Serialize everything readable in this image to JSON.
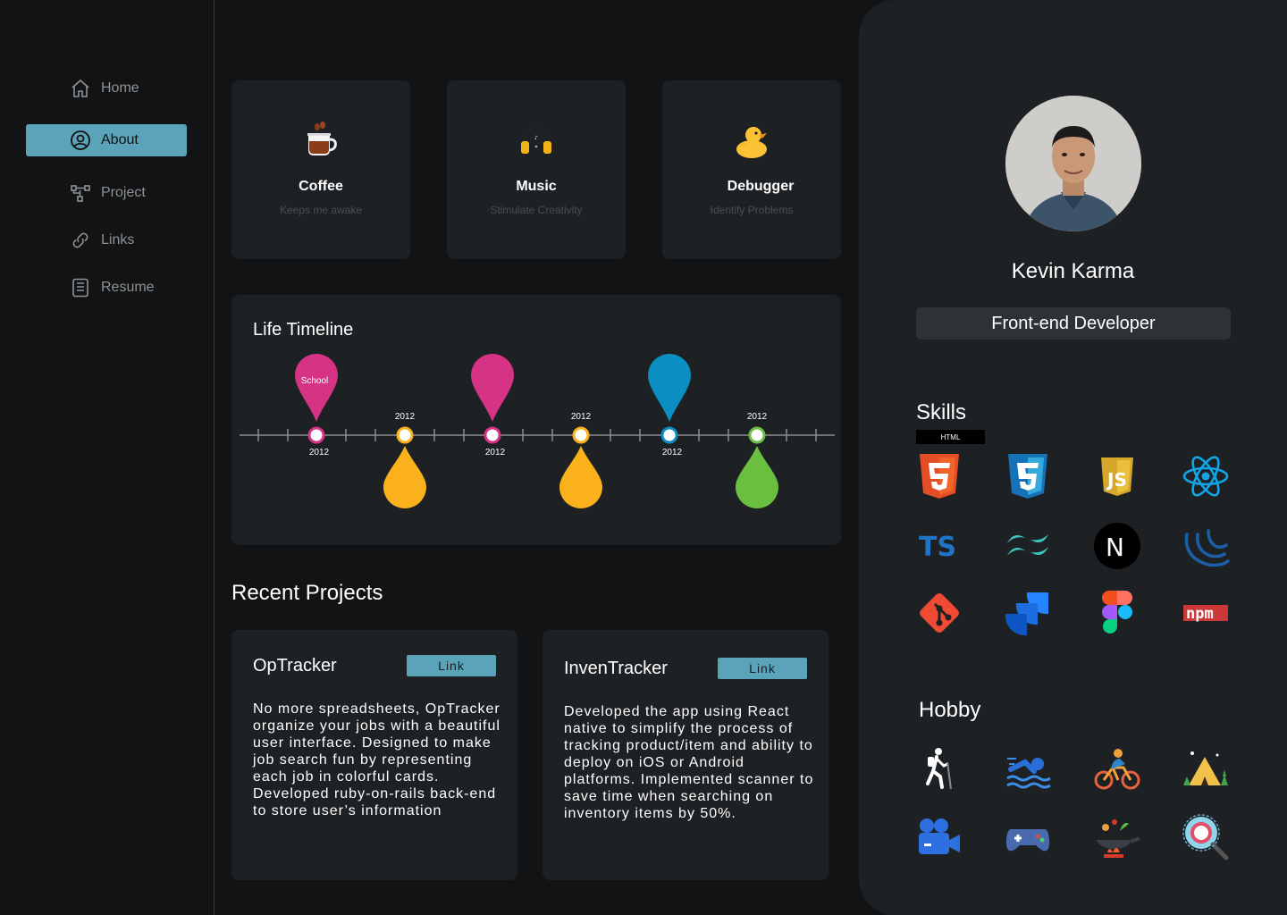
{
  "nav": {
    "items": [
      {
        "label": "Home",
        "icon": "home-icon",
        "active": false
      },
      {
        "label": "About",
        "icon": "user-circle-icon",
        "active": true
      },
      {
        "label": "Project",
        "icon": "project-tree-icon",
        "active": false
      },
      {
        "label": "Links",
        "icon": "link-icon",
        "active": false
      },
      {
        "label": "Resume",
        "icon": "document-icon",
        "active": false
      }
    ]
  },
  "interests": [
    {
      "title": "Coffee",
      "subtitle": "Keeps me awake",
      "icon": "coffee-icon"
    },
    {
      "title": "Music",
      "subtitle": "Stimulate Creativity",
      "icon": "headphones-icon"
    },
    {
      "title": "Debugger",
      "subtitle": "Identify  Problems",
      "icon": "rubber-duck-icon"
    }
  ],
  "timeline": {
    "title": "Life Timeline",
    "pins": [
      {
        "label": "School",
        "year": "2012",
        "color": "#d63384",
        "direction": "up"
      },
      {
        "label": "",
        "year": "2012",
        "color": "#fbb11b",
        "direction": "down"
      },
      {
        "label": "",
        "year": "2012",
        "color": "#d63384",
        "direction": "up"
      },
      {
        "label": "",
        "year": "2012",
        "color": "#fbb11b",
        "direction": "down"
      },
      {
        "label": "",
        "year": "2012",
        "color": "#0b8ec2",
        "direction": "up"
      },
      {
        "label": "",
        "year": "2012",
        "color": "#6abf40",
        "direction": "down"
      }
    ]
  },
  "projects": {
    "title": "Recent Projects",
    "items": [
      {
        "name": "OpTracker",
        "link_label": "Link",
        "description": "No more spreadsheets, OpTracker organize your jobs with a beautiful user interface. Designed to make job search fun by representing each job in colorful cards. Developed ruby-on-rails back-end to store user’s information"
      },
      {
        "name": "InvenTracker",
        "link_label": "Link",
        "description": "Developed the app using React native to simplify the process of tracking product/item and ability to deploy on iOS or Android platforms. Implemented scanner to save time when searching on inventory items by 50%."
      }
    ]
  },
  "profile": {
    "name": "Kevin Karma",
    "role": "Front-end Developer",
    "skills_title": "Skills",
    "skills_tooltip": "HTML",
    "skills": [
      {
        "icon": "html5-icon"
      },
      {
        "icon": "css3-icon"
      },
      {
        "icon": "javascript-icon"
      },
      {
        "icon": "react-icon"
      },
      {
        "icon": "typescript-icon",
        "text": "TS"
      },
      {
        "icon": "tailwind-icon"
      },
      {
        "icon": "nextjs-icon",
        "text": "N"
      },
      {
        "icon": "jquery-icon"
      },
      {
        "icon": "git-icon"
      },
      {
        "icon": "jira-icon"
      },
      {
        "icon": "figma-icon"
      },
      {
        "icon": "npm-icon",
        "text": "npm"
      }
    ],
    "hobby_title": "Hobby",
    "hobbies": [
      {
        "icon": "hiking-icon"
      },
      {
        "icon": "swimming-icon"
      },
      {
        "icon": "cycling-icon"
      },
      {
        "icon": "camping-icon"
      },
      {
        "icon": "video-camera-icon"
      },
      {
        "icon": "gamepad-icon"
      },
      {
        "icon": "cooking-icon"
      },
      {
        "icon": "search-magnifier-icon"
      }
    ]
  },
  "colors": {
    "accent": "#5aa3b8",
    "panel": "#1e2124",
    "background": "#121314"
  }
}
